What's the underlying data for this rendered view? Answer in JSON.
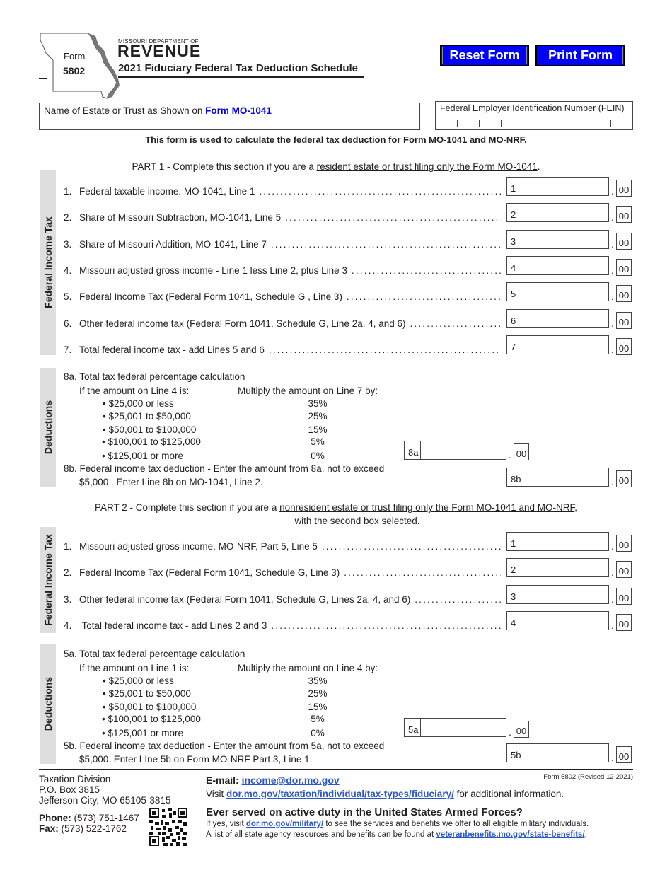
{
  "header": {
    "form_word": "Form",
    "form_number": "5802",
    "department": "MISSOURI DEPARTMENT OF",
    "agency_logo": "REVENUE",
    "title": "2021 Fiduciary Federal Tax Deduction Schedule",
    "map_icon": "missouri-state-outline"
  },
  "buttons": {
    "reset": "Reset Form",
    "print": "Print Form",
    "color": "#0000ff"
  },
  "name_field": {
    "label": "Name of Estate or Trust as Shown on ",
    "link": "Form MO-1041",
    "value": ""
  },
  "fein_field": {
    "label": "Federal Employer Identification Number (FEIN)",
    "value": ""
  },
  "intro": "This form is used to calculate the federal tax deduction for Form MO-1041 and MO-NRF.",
  "part1": {
    "heading_pre": "PART 1 - Complete this section if you are a ",
    "heading_underlined": "resident estate or trust filing only the Form MO-1041",
    "heading_post": ".",
    "side_label": "Federal Income Tax",
    "lines": [
      {
        "num": "1.",
        "text": "Federal taxable income, MO-1041, Line 1",
        "box": "1",
        "value": "",
        "cents": "00"
      },
      {
        "num": "2.",
        "text": "Share of Missouri Subtraction, MO-1041, Line 5",
        "box": "2",
        "value": "",
        "cents": "00"
      },
      {
        "num": "3.",
        "text": "Share of Missouri Addition, MO-1041, Line 7",
        "box": "3",
        "value": "",
        "cents": "00"
      },
      {
        "num": "4.",
        "text": "Missouri adjusted gross income - Line 1 less Line 2, plus Line 3",
        "box": "4",
        "value": "",
        "cents": "00"
      },
      {
        "num": "5.",
        "text": "Federal Income Tax  (Federal Form 1041, Schedule G , Line 3)",
        "box": "5",
        "value": "",
        "cents": "00"
      },
      {
        "num": "6.",
        "text": "Other federal income tax (Federal Form 1041, Schedule G, Line 2a, 4, and 6)",
        "box": "6",
        "value": "",
        "cents": "00"
      },
      {
        "num": "7.",
        "text": "Total federal income tax - add Lines 5 and 6",
        "box": "7",
        "value": "",
        "cents": "00"
      }
    ],
    "deductions": {
      "side_label": "Deductions",
      "title": "8a. Total tax federal percentage calculation",
      "if_label": "If the amount on Line 4 is:",
      "multiply_label": "Multiply the amount on Line 7 by:",
      "brackets": [
        {
          "range": "• $25,000 or less",
          "pct": "35%"
        },
        {
          "range": "• $25,001 to $50,000",
          "pct": "25%"
        },
        {
          "range": "• $50,001 to $100,000",
          "pct": "15%"
        },
        {
          "range": "• $100,001 to $125,000",
          "pct": "5%"
        },
        {
          "range": "• $125,001 or more",
          "pct": "0%"
        }
      ],
      "box_a": "8a",
      "value_a": "",
      "cents_a": "00",
      "b_line1": "8b. Federal income tax deduction - Enter the amount from 8a, not to exceed",
      "b_line2": "$5,000 . Enter Line 8b on MO-1041, Line 2.",
      "box_b": "8b",
      "value_b": "",
      "cents_b": "00"
    }
  },
  "part2": {
    "heading_pre": "PART 2 -  Complete this section if you are a ",
    "heading_underlined": "nonresident estate or trust filing only the Form MO-1041 and MO-NRF",
    "heading_post": ",",
    "heading_line2": "with the second box selected.",
    "side_label": "Federal Income Tax",
    "lines": [
      {
        "num": "1.",
        "text": "Missouri adjusted gross income, MO-NRF, Part 5, Line 5",
        "box": "1",
        "value": "",
        "cents": "00"
      },
      {
        "num": "2.",
        "text": "Federal Income Tax (Federal Form 1041, Schedule G, Line 3)",
        "box": "2",
        "value": "",
        "cents": "00"
      },
      {
        "num": "3.",
        "text": "Other federal income tax (Federal Form 1041, Schedule G, Lines 2a, 4, and 6)",
        "box": "3",
        "value": "",
        "cents": "00"
      },
      {
        "num": "4.",
        "text": " Total federal income tax - add Lines 2 and 3",
        "box": "4",
        "value": "",
        "cents": "00"
      }
    ],
    "deductions": {
      "side_label": "Deductions",
      "title": "5a. Total tax federal percentage calculation",
      "if_label": "If the amount on Line 1 is:",
      "multiply_label": "Multiply the amount on Line 4 by:",
      "brackets": [
        {
          "range": "• $25,000 or less",
          "pct": "35%"
        },
        {
          "range": "• $25,001 to $50,000",
          "pct": "25%"
        },
        {
          "range": "• $50,001 to $100,000",
          "pct": "15%"
        },
        {
          "range": "• $100,001 to $125,000",
          "pct": "5%"
        },
        {
          "range": "• $125,001 or more",
          "pct": "0%"
        }
      ],
      "box_a": "5a",
      "value_a": "",
      "cents_a": "00",
      "b_line1": "5b. Federal income tax deduction - Enter the amount from 5a, not to exceed",
      "b_line2": "$5,000. Enter LIne 5b on Form MO-NRF Part 3, Line 1.",
      "box_b": "5b",
      "value_b": "",
      "cents_b": "00"
    }
  },
  "footer": {
    "address": [
      "Taxation Division",
      "P.O. Box 3815",
      "Jefferson City, MO 65105-3815"
    ],
    "phone_label": "Phone:",
    "phone": " (573) 751-1467",
    "fax_label": "Fax:",
    "fax": " (573) 522-1762",
    "email_label": "E-mail: ",
    "email": "income@dor.mo.gov",
    "revised": "Form 5802 (Revised 12-2021)",
    "visit_pre": "Visit ",
    "visit_link": "dor.mo.gov/taxation/individual/tax-types/fiduciary/",
    "visit_post": " for additional information.",
    "armed_heading": "Ever served on active duty in the United States Armed Forces?",
    "mil_pre": "If yes, visit ",
    "mil_link": "dor.mo.gov/military/",
    "mil_post": " to see the services and benefits we offer to all eligible military individuals.",
    "vet_pre": "A list of all state agency resources and benefits can be found at ",
    "vet_link": "veteranbenefits.mo.gov/state-benefits/",
    "vet_post": ".",
    "link_color": "#2b58c8",
    "qr_icon": "qr-code"
  }
}
